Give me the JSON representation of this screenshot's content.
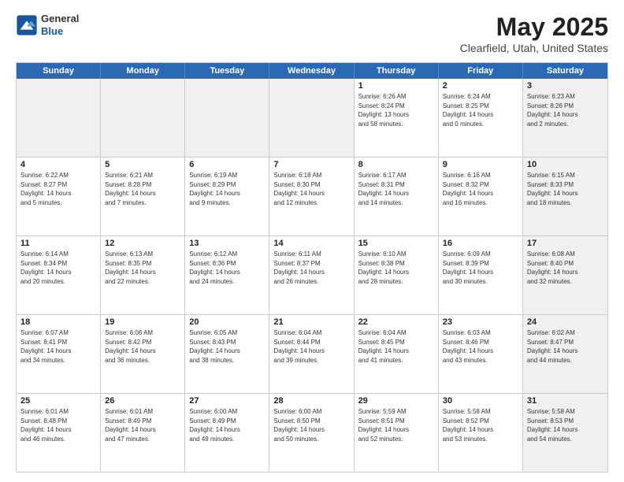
{
  "header": {
    "logo_general": "General",
    "logo_blue": "Blue",
    "main_title": "May 2025",
    "subtitle": "Clearfield, Utah, United States"
  },
  "days_of_week": [
    "Sunday",
    "Monday",
    "Tuesday",
    "Wednesday",
    "Thursday",
    "Friday",
    "Saturday"
  ],
  "rows": [
    [
      {
        "day": "",
        "info": "",
        "shaded": true
      },
      {
        "day": "",
        "info": "",
        "shaded": true
      },
      {
        "day": "",
        "info": "",
        "shaded": true
      },
      {
        "day": "",
        "info": "",
        "shaded": true
      },
      {
        "day": "1",
        "info": "Sunrise: 6:26 AM\nSunset: 8:24 PM\nDaylight: 13 hours\nand 58 minutes."
      },
      {
        "day": "2",
        "info": "Sunrise: 6:24 AM\nSunset: 8:25 PM\nDaylight: 14 hours\nand 0 minutes."
      },
      {
        "day": "3",
        "info": "Sunrise: 6:23 AM\nSunset: 8:26 PM\nDaylight: 14 hours\nand 2 minutes.",
        "shaded": true
      }
    ],
    [
      {
        "day": "4",
        "info": "Sunrise: 6:22 AM\nSunset: 8:27 PM\nDaylight: 14 hours\nand 5 minutes."
      },
      {
        "day": "5",
        "info": "Sunrise: 6:21 AM\nSunset: 8:28 PM\nDaylight: 14 hours\nand 7 minutes."
      },
      {
        "day": "6",
        "info": "Sunrise: 6:19 AM\nSunset: 8:29 PM\nDaylight: 14 hours\nand 9 minutes."
      },
      {
        "day": "7",
        "info": "Sunrise: 6:18 AM\nSunset: 8:30 PM\nDaylight: 14 hours\nand 12 minutes."
      },
      {
        "day": "8",
        "info": "Sunrise: 6:17 AM\nSunset: 8:31 PM\nDaylight: 14 hours\nand 14 minutes."
      },
      {
        "day": "9",
        "info": "Sunrise: 6:16 AM\nSunset: 8:32 PM\nDaylight: 14 hours\nand 16 minutes."
      },
      {
        "day": "10",
        "info": "Sunrise: 6:15 AM\nSunset: 8:33 PM\nDaylight: 14 hours\nand 18 minutes.",
        "shaded": true
      }
    ],
    [
      {
        "day": "11",
        "info": "Sunrise: 6:14 AM\nSunset: 8:34 PM\nDaylight: 14 hours\nand 20 minutes."
      },
      {
        "day": "12",
        "info": "Sunrise: 6:13 AM\nSunset: 8:35 PM\nDaylight: 14 hours\nand 22 minutes."
      },
      {
        "day": "13",
        "info": "Sunrise: 6:12 AM\nSunset: 8:36 PM\nDaylight: 14 hours\nand 24 minutes."
      },
      {
        "day": "14",
        "info": "Sunrise: 6:11 AM\nSunset: 8:37 PM\nDaylight: 14 hours\nand 26 minutes."
      },
      {
        "day": "15",
        "info": "Sunrise: 6:10 AM\nSunset: 8:38 PM\nDaylight: 14 hours\nand 28 minutes."
      },
      {
        "day": "16",
        "info": "Sunrise: 6:09 AM\nSunset: 8:39 PM\nDaylight: 14 hours\nand 30 minutes."
      },
      {
        "day": "17",
        "info": "Sunrise: 6:08 AM\nSunset: 8:40 PM\nDaylight: 14 hours\nand 32 minutes.",
        "shaded": true
      }
    ],
    [
      {
        "day": "18",
        "info": "Sunrise: 6:07 AM\nSunset: 8:41 PM\nDaylight: 14 hours\nand 34 minutes."
      },
      {
        "day": "19",
        "info": "Sunrise: 6:06 AM\nSunset: 8:42 PM\nDaylight: 14 hours\nand 36 minutes."
      },
      {
        "day": "20",
        "info": "Sunrise: 6:05 AM\nSunset: 8:43 PM\nDaylight: 14 hours\nand 38 minutes."
      },
      {
        "day": "21",
        "info": "Sunrise: 6:04 AM\nSunset: 8:44 PM\nDaylight: 14 hours\nand 39 minutes."
      },
      {
        "day": "22",
        "info": "Sunrise: 6:04 AM\nSunset: 8:45 PM\nDaylight: 14 hours\nand 41 minutes."
      },
      {
        "day": "23",
        "info": "Sunrise: 6:03 AM\nSunset: 8:46 PM\nDaylight: 14 hours\nand 43 minutes."
      },
      {
        "day": "24",
        "info": "Sunrise: 6:02 AM\nSunset: 8:47 PM\nDaylight: 14 hours\nand 44 minutes.",
        "shaded": true
      }
    ],
    [
      {
        "day": "25",
        "info": "Sunrise: 6:01 AM\nSunset: 8:48 PM\nDaylight: 14 hours\nand 46 minutes."
      },
      {
        "day": "26",
        "info": "Sunrise: 6:01 AM\nSunset: 8:49 PM\nDaylight: 14 hours\nand 47 minutes."
      },
      {
        "day": "27",
        "info": "Sunrise: 6:00 AM\nSunset: 8:49 PM\nDaylight: 14 hours\nand 49 minutes."
      },
      {
        "day": "28",
        "info": "Sunrise: 6:00 AM\nSunset: 8:50 PM\nDaylight: 14 hours\nand 50 minutes."
      },
      {
        "day": "29",
        "info": "Sunrise: 5:59 AM\nSunset: 8:51 PM\nDaylight: 14 hours\nand 52 minutes."
      },
      {
        "day": "30",
        "info": "Sunrise: 5:58 AM\nSunset: 8:52 PM\nDaylight: 14 hours\nand 53 minutes."
      },
      {
        "day": "31",
        "info": "Sunrise: 5:58 AM\nSunset: 8:53 PM\nDaylight: 14 hours\nand 54 minutes.",
        "shaded": true
      }
    ]
  ]
}
